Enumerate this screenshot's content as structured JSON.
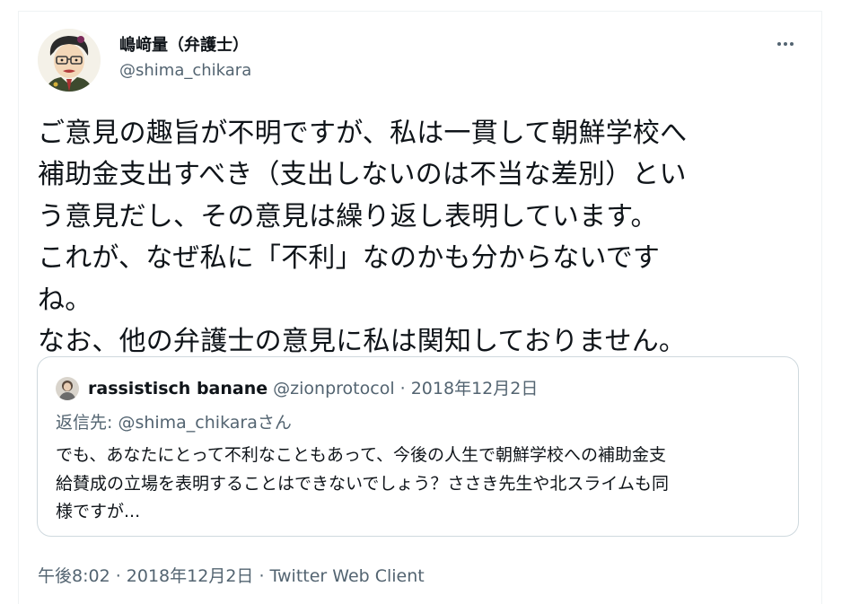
{
  "author": {
    "display_name": "嶋﨑量（弁護士）",
    "handle": "@shima_chikara"
  },
  "tweet": {
    "lines": [
      "ご意見の趣旨が不明ですが、私は一貫して朝鮮学校へ",
      "補助金支出すべき（支出しないのは不当な差別）とい",
      "う意見だし、その意見は繰り返し表明しています。",
      "これが、なぜ私に「不利」なのかも分からないです",
      "ね。",
      "なお、他の弁護士の意見に私は関知しておりません。"
    ]
  },
  "quoted": {
    "name": "rassistisch banane",
    "handle": "@zionprotocol",
    "separator": " · ",
    "date": "2018年12月2日",
    "reply_to": "返信先: @shima_chikaraさん",
    "body_lines": [
      "でも、あなたにとって不利なこともあって、今後の人生で朝鮮学校への補助金支",
      "給賛成の立場を表明することはできないでしょう？ささき先生や北スライムも同",
      "様ですが..."
    ]
  },
  "footer": {
    "time": "午後8:02",
    "sep1": " · ",
    "date": "2018年12月2日",
    "sep2": " · ",
    "client": "Twitter Web Client"
  },
  "icons": {
    "more": "more-horizontal-icon"
  }
}
